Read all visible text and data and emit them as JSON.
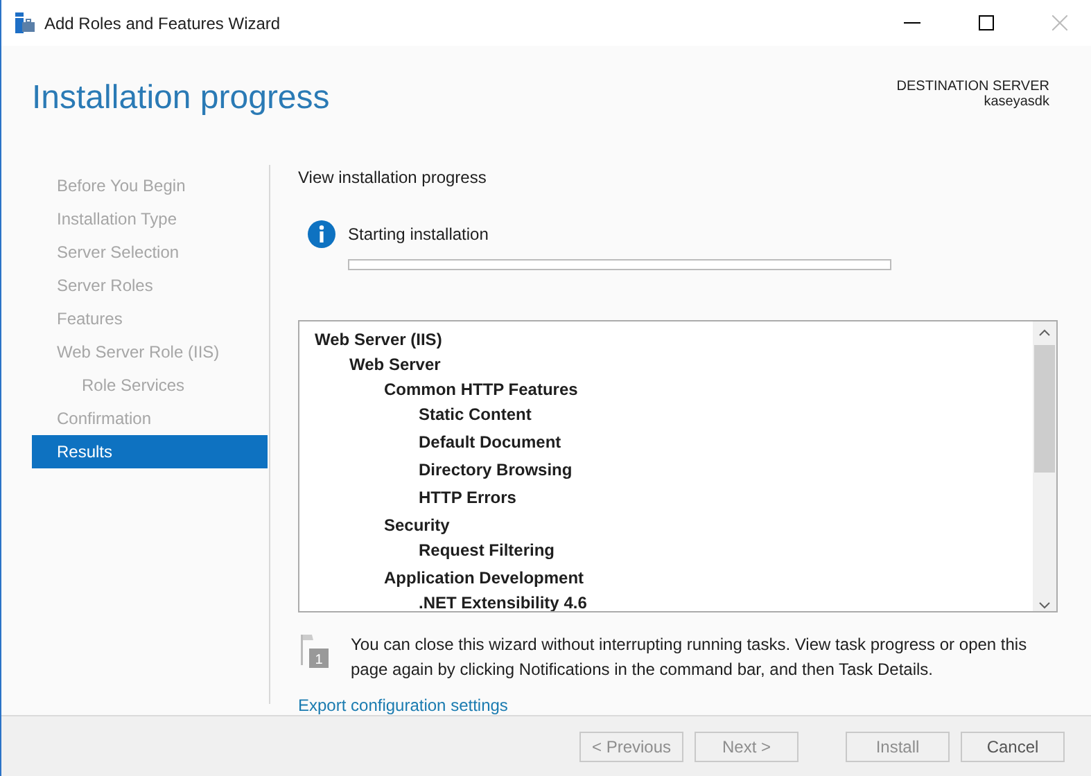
{
  "window": {
    "title": "Add Roles and Features Wizard"
  },
  "header": {
    "title": "Installation progress",
    "destination_label": "DESTINATION SERVER",
    "destination_server": "kaseyasdk"
  },
  "steps": [
    {
      "label": "Before You Begin",
      "selected": false,
      "indented": false
    },
    {
      "label": "Installation Type",
      "selected": false,
      "indented": false
    },
    {
      "label": "Server Selection",
      "selected": false,
      "indented": false
    },
    {
      "label": "Server Roles",
      "selected": false,
      "indented": false
    },
    {
      "label": "Features",
      "selected": false,
      "indented": false
    },
    {
      "label": "Web Server Role (IIS)",
      "selected": false,
      "indented": false
    },
    {
      "label": "Role Services",
      "selected": false,
      "indented": true
    },
    {
      "label": "Confirmation",
      "selected": false,
      "indented": false
    },
    {
      "label": "Results",
      "selected": true,
      "indented": false
    }
  ],
  "content": {
    "heading": "View installation progress",
    "status": "Starting installation",
    "progress": {
      "level": 0
    },
    "tree": [
      {
        "label": "Web Server (IIS)",
        "children": [
          {
            "label": "Web Server",
            "children": [
              {
                "label": "Common HTTP Features",
                "children": [
                  {
                    "label": "Static Content"
                  },
                  {
                    "label": "Default Document"
                  },
                  {
                    "label": "Directory Browsing"
                  },
                  {
                    "label": "HTTP Errors"
                  }
                ]
              },
              {
                "label": "Security",
                "children": [
                  {
                    "label": "Request Filtering"
                  }
                ]
              },
              {
                "label": "Application Development",
                "children": [
                  {
                    "label": ".NET Extensibility 4.6"
                  }
                ]
              }
            ]
          }
        ]
      }
    ],
    "notice": {
      "badge": "1",
      "text": "You can close this wizard without interrupting running tasks. View task progress or open this page again by clicking Notifications in the command bar, and then Task Details."
    },
    "export_link": "Export configuration settings"
  },
  "buttons": [
    {
      "label": "< Previous",
      "disabled": true
    },
    {
      "label": "Next >",
      "disabled": true
    },
    {
      "label": "Install",
      "disabled": true
    },
    {
      "label": "Cancel",
      "disabled": false
    }
  ]
}
